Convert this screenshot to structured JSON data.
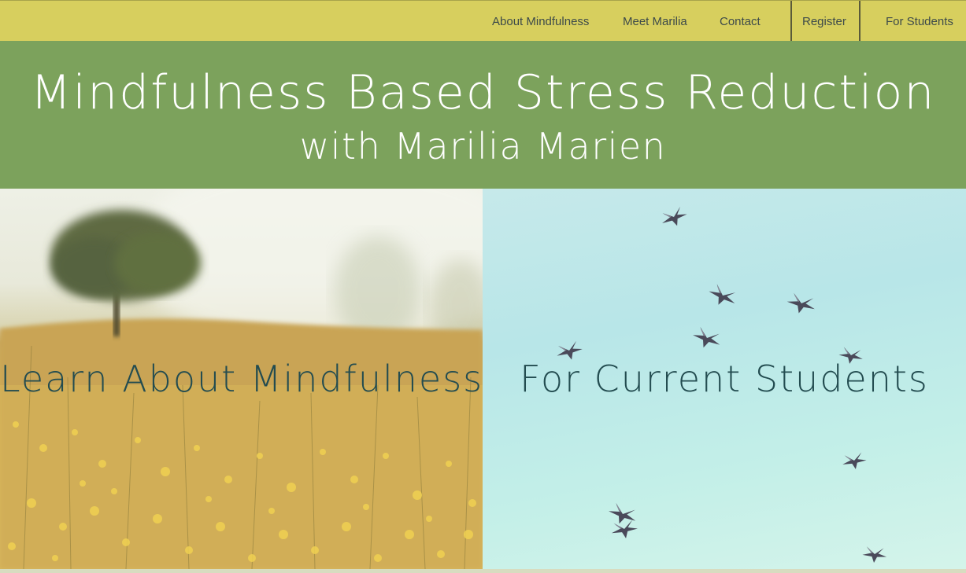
{
  "nav": {
    "items": [
      {
        "label": "About Mindfulness"
      },
      {
        "label": "Meet Marilia"
      },
      {
        "label": "Contact"
      },
      {
        "label": "Register"
      },
      {
        "label": "For Students"
      }
    ]
  },
  "header": {
    "title": "Mindfulness Based Stress Reduction",
    "subtitle": "with Marilia Marien"
  },
  "panels": {
    "left": {
      "label": "Learn About Mindfulness",
      "image": "meadow-tree-image"
    },
    "right": {
      "label": "For Current Students",
      "image": "birds-sky-image"
    }
  },
  "colors": {
    "nav_bg": "#d7cf5e",
    "band_bg": "#7ca25c",
    "panel_text": "#234c50"
  }
}
